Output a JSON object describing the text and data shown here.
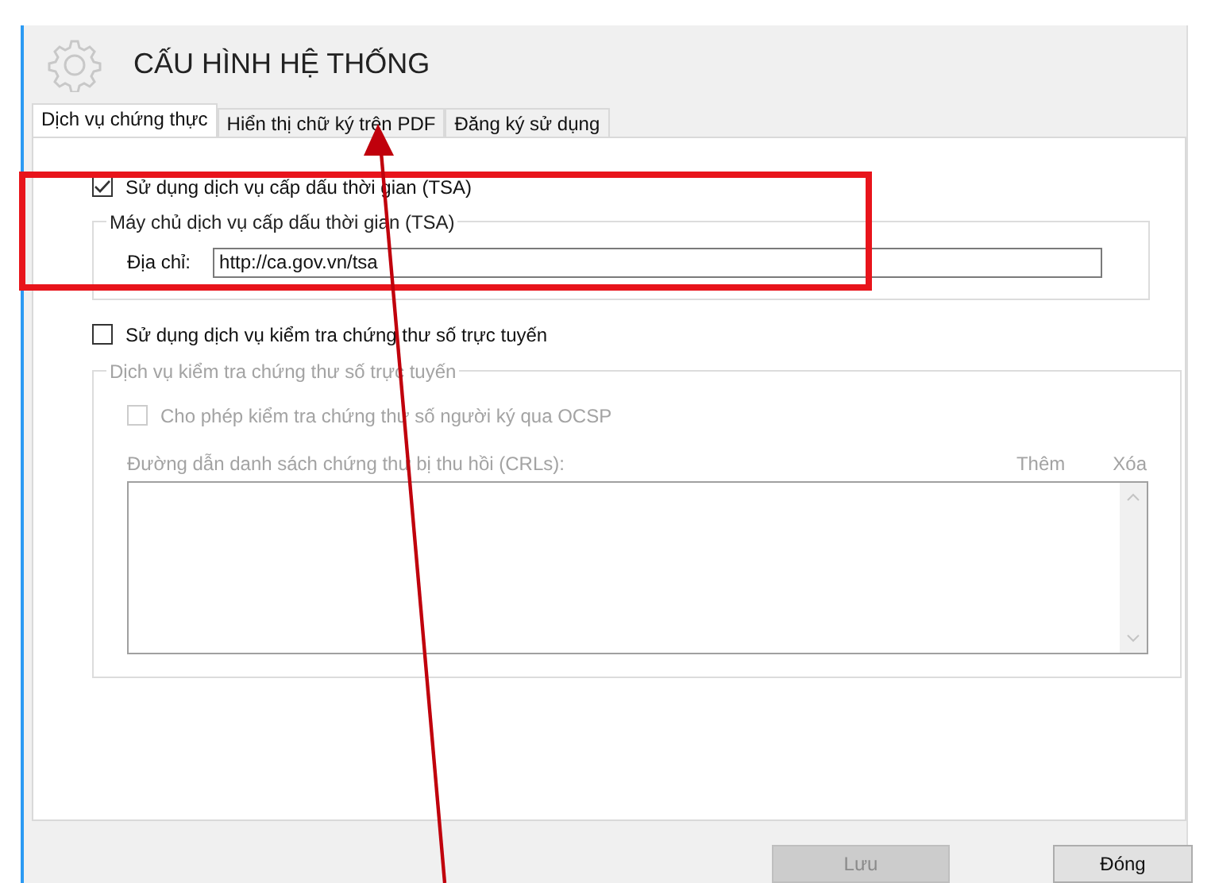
{
  "window": {
    "title": "CẤU HÌNH HỆ THỐNG"
  },
  "tabs": [
    {
      "label": "Dịch vụ chứng thực",
      "selected": true
    },
    {
      "label": "Hiển thị chữ ký trên PDF",
      "selected": false
    },
    {
      "label": "Đăng ký sử dụng",
      "selected": false
    }
  ],
  "tsa": {
    "label": "Sử dụng dịch vụ cấp dấu thời gian (TSA)",
    "checked": true,
    "group": "Máy chủ dịch vụ cấp dấu thời gian (TSA)",
    "address_label": "Địa chỉ:",
    "address": "http://ca.gov.vn/tsa"
  },
  "online_check": {
    "label": "Sử dụng dịch vụ kiểm tra chứng thư số trực tuyến",
    "checked": false,
    "group": "Dịch vụ kiểm tra chứng thư số trực tuyến",
    "ocsp": {
      "label": "Cho phép kiểm tra chứng thư số người ký qua OCSP",
      "checked": false
    },
    "crl_label": "Đường dẫn danh sách chứng thư bị thu hồi (CRLs):",
    "links": [
      "Thêm",
      "Xóa"
    ]
  },
  "buttons": [
    {
      "label": "Lưu",
      "disabled": true
    },
    {
      "label": "Đóng",
      "disabled": false
    }
  ]
}
